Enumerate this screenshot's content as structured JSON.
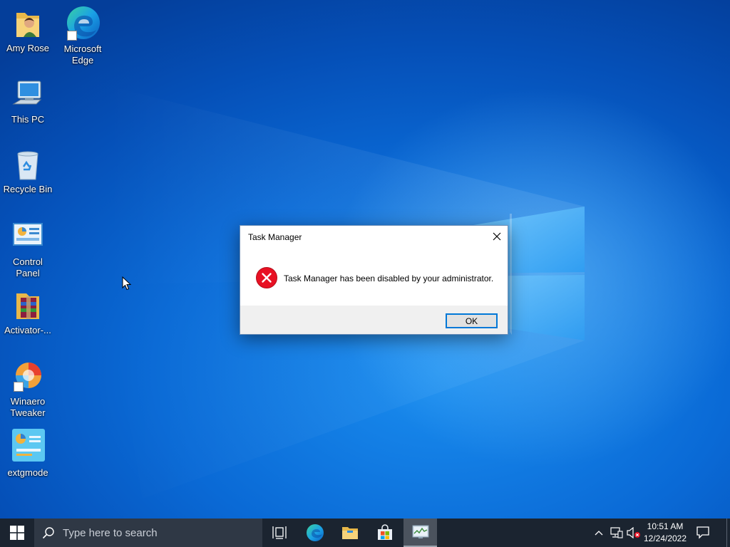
{
  "desktop": {
    "icons": [
      {
        "label": "Amy Rose",
        "icon": "user-folder-icon"
      },
      {
        "label": "Microsoft Edge",
        "icon": "edge-icon"
      },
      {
        "label": "This PC",
        "icon": "computer-icon"
      },
      {
        "label": "Recycle Bin",
        "icon": "recycle-bin-icon"
      },
      {
        "label": "Control Panel",
        "icon": "control-panel-icon"
      },
      {
        "label": "Activator-...",
        "icon": "winrar-archive-icon"
      },
      {
        "label": "Winaero Tweaker",
        "icon": "winaero-tweaker-icon"
      },
      {
        "label": "extgmode",
        "icon": "extgmode-icon"
      }
    ]
  },
  "dialog": {
    "title": "Task Manager",
    "message": "Task Manager has been disabled by your administrator.",
    "ok_label": "OK",
    "icon": "error-icon",
    "close_icon": "close-icon"
  },
  "taskbar": {
    "start_icon": "windows-logo-icon",
    "search_placeholder": "Type here to search",
    "pinned": [
      "task-view-icon",
      "edge-icon",
      "file-explorer-icon",
      "microsoft-store-icon",
      "task-manager-icon"
    ],
    "active_app": "task-manager-icon",
    "tray": {
      "icons": [
        "chevron-up-icon",
        "network-icon",
        "volume-muted-icon"
      ],
      "time": "10:51 AM",
      "date": "12/24/2022"
    },
    "notification_icon": "notification-icon"
  },
  "colors": {
    "accent": "#0078d7",
    "error_red": "#e81123",
    "taskbar_bg": "#1b2430",
    "desktop_blue": "#0a6ad6"
  }
}
